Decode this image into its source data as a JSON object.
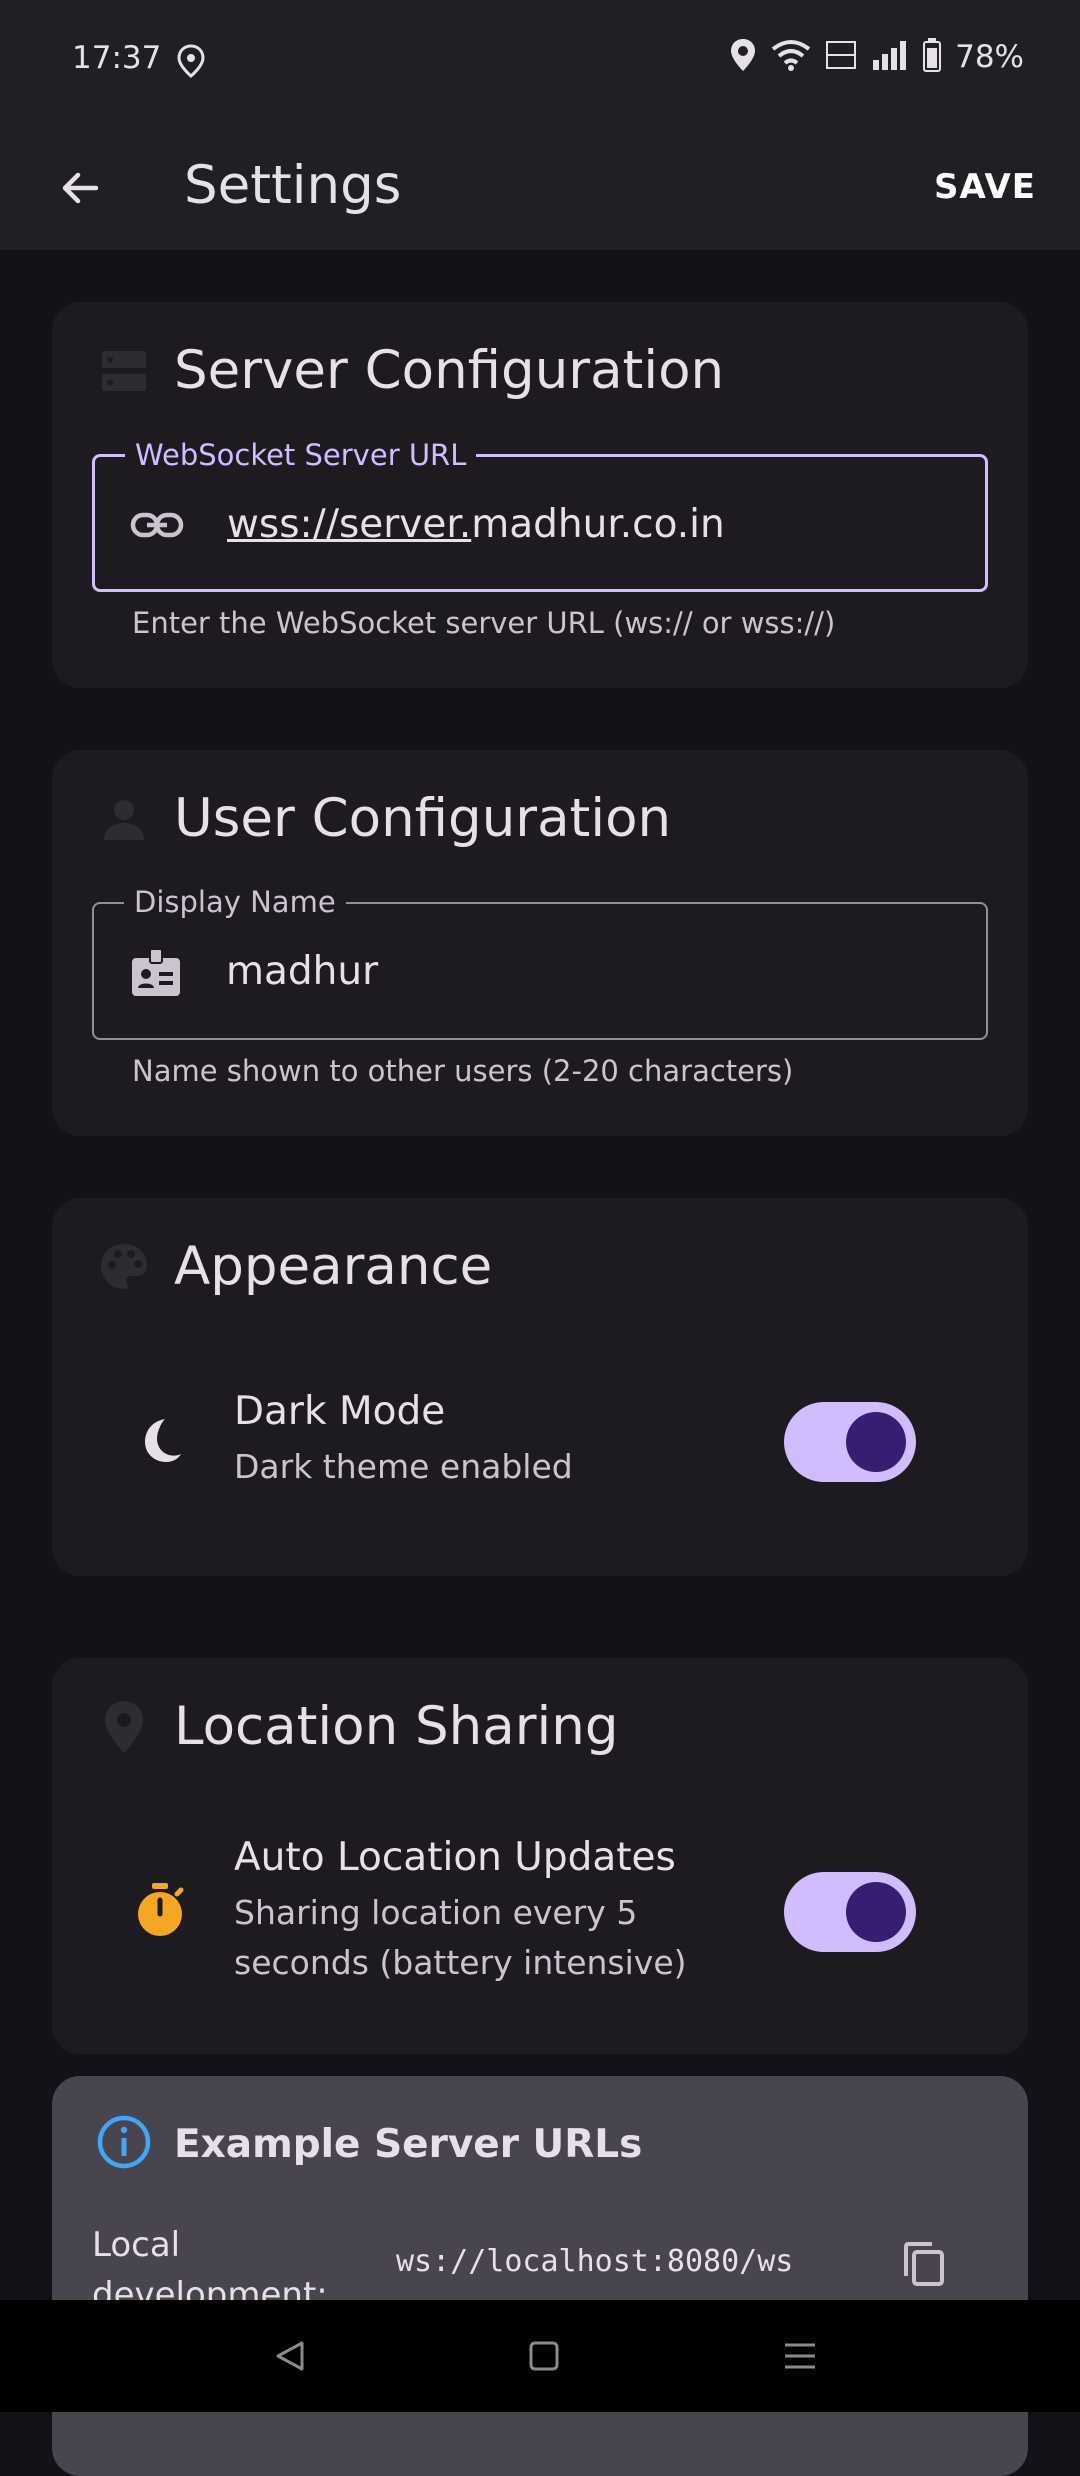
{
  "status_bar": {
    "time": "17:37",
    "battery": "78%"
  },
  "app_bar": {
    "title": "Settings",
    "save_label": "SAVE"
  },
  "server_config": {
    "title": "Server Configuration",
    "field_label": "WebSocket Server URL",
    "field_value_underlined": "wss://server.",
    "field_value_rest": "madhur.co.in",
    "helper": "Enter the WebSocket server URL (ws:// or wss://)"
  },
  "user_config": {
    "title": "User Configuration",
    "field_label": "Display Name",
    "field_value": "madhur",
    "helper": "Name shown to other users (2-20 characters)"
  },
  "appearance": {
    "title": "Appearance",
    "dark_mode_title": "Dark Mode",
    "dark_mode_subtitle": "Dark theme enabled",
    "dark_mode_enabled": true
  },
  "location": {
    "title": "Location Sharing",
    "auto_title": "Auto Location Updates",
    "auto_subtitle_line1": "Sharing location every 5",
    "auto_subtitle_line2": "seconds (battery intensive)",
    "auto_enabled": true
  },
  "examples": {
    "title": "Example Server URLs",
    "items": [
      {
        "label_line1": "Local",
        "label_line2": "development:",
        "url": "ws://localhost:8080/ws"
      }
    ]
  },
  "colors": {
    "primary": "#d0bcff",
    "on_primary": "#381e72",
    "background": "#141218",
    "card": "#1d1b20",
    "timer_orange": "#f5a623",
    "info_blue": "#42a5f5"
  },
  "icons": {
    "back": "arrow-left-icon",
    "server": "dns-icon",
    "link": "link-icon",
    "user": "person-icon",
    "badge": "badge-icon",
    "palette": "palette-icon",
    "moon": "moon-icon",
    "location": "location-pin-icon",
    "timer": "timer-icon",
    "info": "info-icon",
    "copy": "copy-icon"
  }
}
